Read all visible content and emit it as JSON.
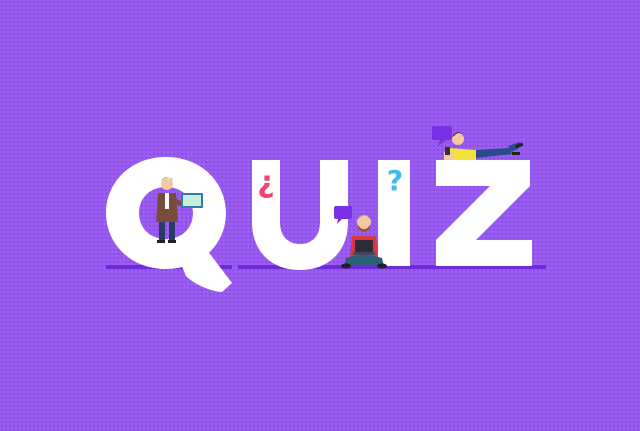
{
  "title": "QUIZ",
  "marks": {
    "inverted_question": "¿",
    "question": "?"
  },
  "colors": {
    "background": "#9b5cf2",
    "letters": "#ffffff",
    "baseline": "#6f2bd9",
    "inverted_question_mark": "#f0456f",
    "question_mark": "#41b8f0",
    "speech_bubble": "#7b2fe6"
  },
  "icons": [
    "person-with-tablet",
    "person-with-laptop",
    "person-lying-with-phone",
    "speech-bubble-icon"
  ]
}
